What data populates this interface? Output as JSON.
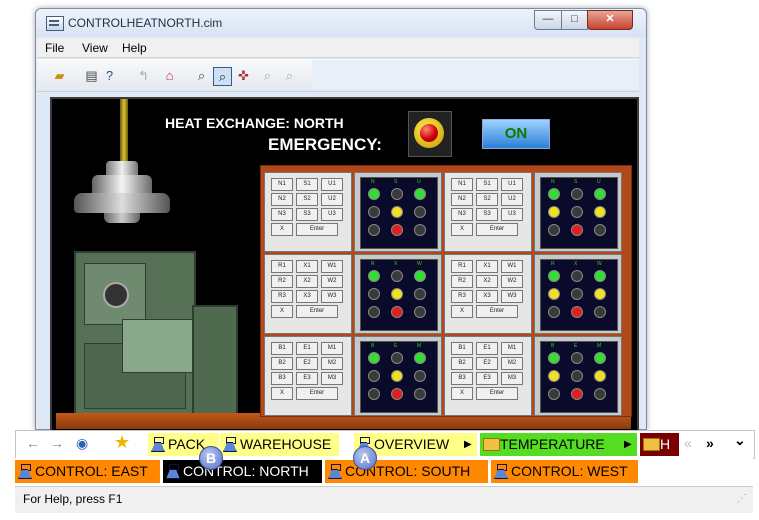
{
  "window": {
    "title": "CONTROLHEATNORTH.cim",
    "min": "—",
    "max": "□",
    "close": "✕"
  },
  "menu": [
    "File",
    "View",
    "Help"
  ],
  "toolbar": {
    "icons": [
      "open-folder-icon",
      "print-icon",
      "help-pointer-icon",
      "go-back-icon",
      "home-icon",
      "zoom-icon",
      "zoom-area-icon",
      "zoom-fit-icon",
      "zoom-in-icon",
      "zoom-out-icon"
    ]
  },
  "hmi": {
    "title": "HEAT EXCHANGE: NORTH",
    "emergency_label": "EMERGENCY:",
    "on_button": "ON",
    "keypads": [
      {
        "rows": [
          [
            "N1",
            "S1",
            "U1"
          ],
          [
            "N2",
            "S2",
            "U2"
          ],
          [
            "N3",
            "S3",
            "U3"
          ]
        ],
        "x": "X",
        "enter": "Enter"
      },
      {
        "rows": [
          [
            "R1",
            "X1",
            "W1"
          ],
          [
            "R2",
            "X2",
            "W2"
          ],
          [
            "R3",
            "X3",
            "W3"
          ]
        ],
        "x": "X",
        "enter": "Enter"
      },
      {
        "rows": [
          [
            "B1",
            "E1",
            "M1"
          ],
          [
            "B2",
            "E2",
            "M2"
          ],
          [
            "B3",
            "E3",
            "M3"
          ]
        ],
        "x": "X",
        "enter": "Enter"
      }
    ],
    "led_labels": [
      [
        "N",
        "S",
        "U"
      ],
      [
        "R",
        "X",
        "W"
      ],
      [
        "B",
        "E",
        "M"
      ]
    ],
    "led_colors": {
      "green": "#33dd33",
      "yellow": "#f0e020",
      "red": "#e02020",
      "off": "#3a3a3a"
    }
  },
  "navbar": {
    "back": "←",
    "forward": "→",
    "globe": "◉",
    "star": "★",
    "tabs": [
      "PACK",
      "WAREHOUSE",
      "OVERVIEW",
      "TEMPERATURE",
      "H"
    ],
    "scroll_left": "«",
    "scroll_right": "»",
    "dropdown": "⌄"
  },
  "tabs2": [
    "CONTROL: EAST",
    "CONTROL: NORTH",
    "CONTROL: SOUTH",
    "CONTROL: WEST"
  ],
  "badges": {
    "a": "A",
    "b": "B"
  },
  "status": "For Help, press F1",
  "colors": {
    "orange": "#ff8800",
    "yellow": "#ffff88",
    "green": "#55dd22",
    "darkred": "#7a0000",
    "black": "#000000"
  }
}
